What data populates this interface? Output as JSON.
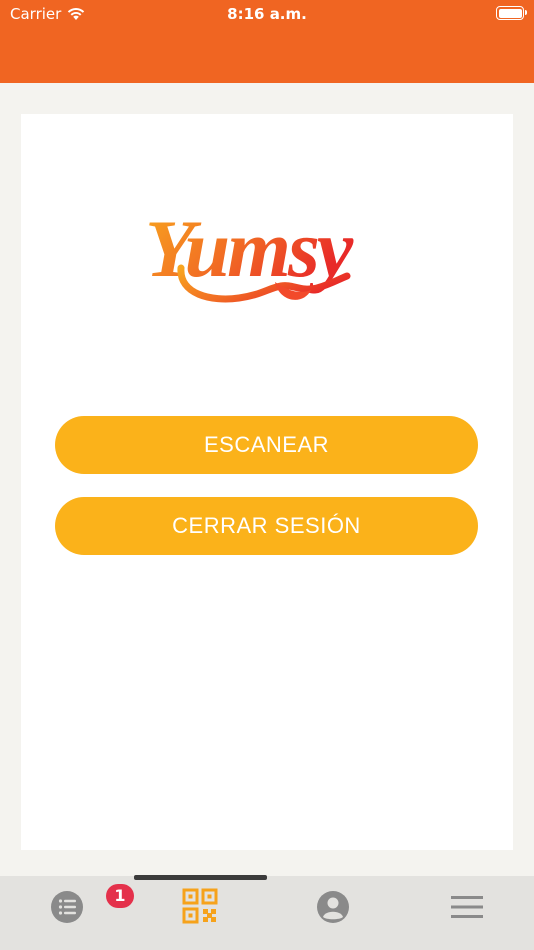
{
  "status_bar": {
    "carrier": "Carrier",
    "time": "8:16 a.m."
  },
  "brand": {
    "logo_text": "Yumsy",
    "colors": {
      "header": "#f06522",
      "button": "#fbb21a",
      "badge": "#e4314b",
      "active_tab": "#f6a21b"
    }
  },
  "actions": {
    "scan_label": "ESCANEAR",
    "logout_label": "CERRAR SESIÓN"
  },
  "tab_bar": {
    "items": [
      {
        "icon": "list-icon",
        "badge": "1"
      },
      {
        "icon": "qr-code-icon",
        "active": true
      },
      {
        "icon": "user-icon"
      },
      {
        "icon": "menu-icon"
      }
    ]
  }
}
